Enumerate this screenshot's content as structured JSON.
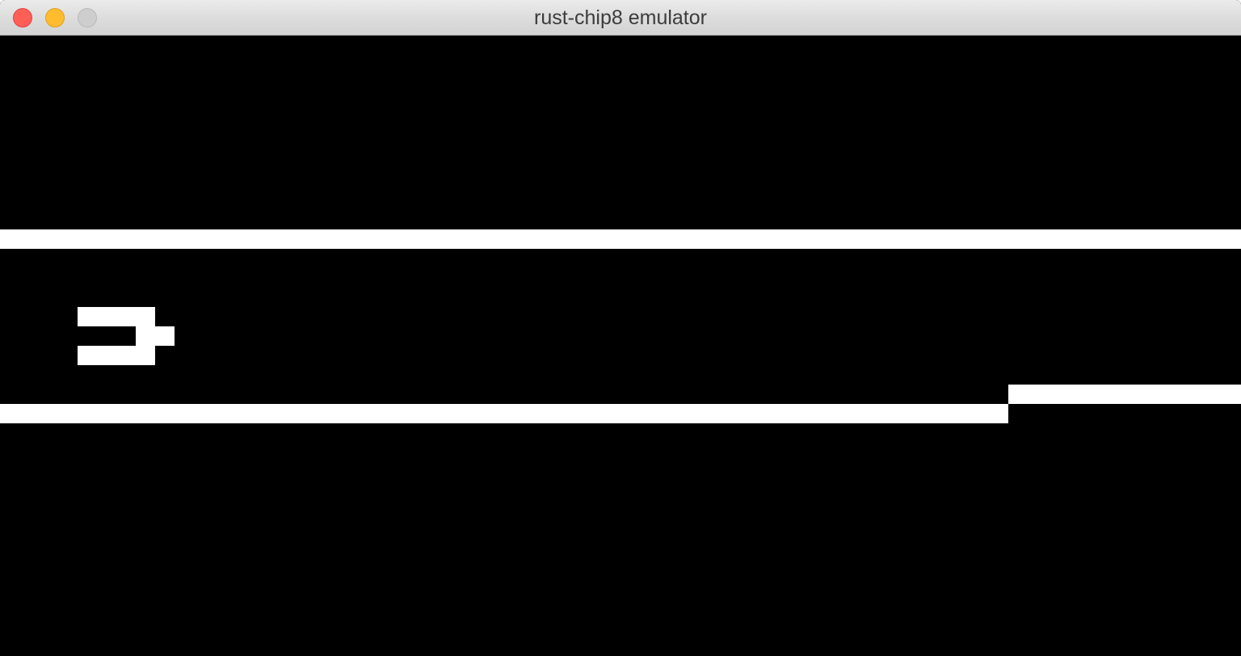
{
  "window": {
    "title": "rust-chip8 emulator",
    "controls": {
      "close_color": "#fd5f57",
      "minimize_color": "#febc2e",
      "zoom_color": "#cecece"
    }
  },
  "display": {
    "resolution": "64x32",
    "background_color": "#000000",
    "pixel_color": "#ffffff"
  }
}
